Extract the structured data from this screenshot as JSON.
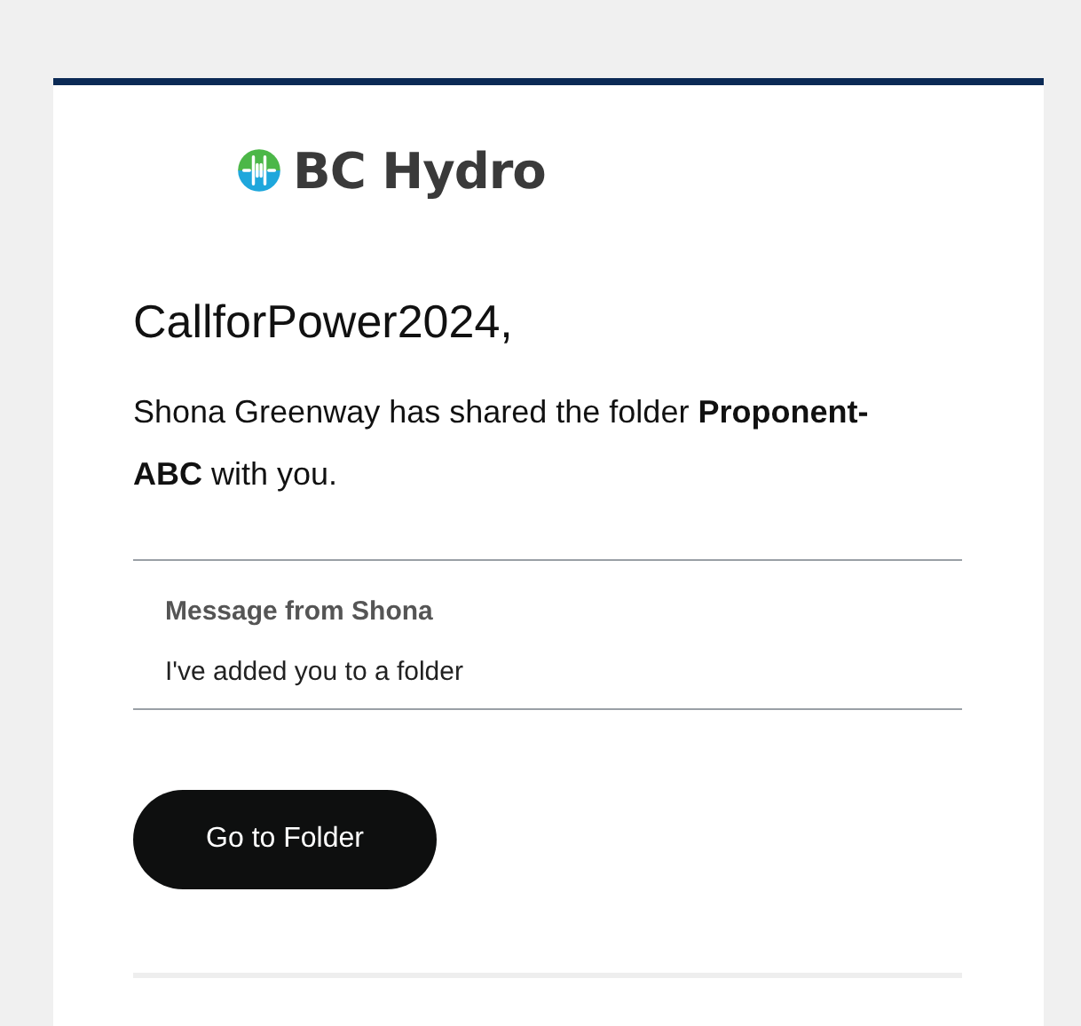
{
  "logo": {
    "text": "BC Hydro"
  },
  "greeting": "CallforPower2024,",
  "message": "Shona Greenway has shared the folder **Proponent-ABC** with you.",
  "note": {
    "heading": "Message from Shona",
    "text": "I've added you to a folder"
  },
  "button": {
    "label": "Go to Folder"
  }
}
